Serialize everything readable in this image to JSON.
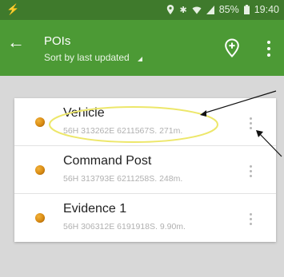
{
  "status": {
    "battery": "85%",
    "time": "19:40",
    "left_icon": "lightning-icon",
    "icons": [
      "location-pin-icon",
      "bluetooth-icon",
      "wifi-icon",
      "signal-icon",
      "battery-icon"
    ]
  },
  "toolbar": {
    "title": "POIs",
    "subtitle": "Sort by last updated",
    "icons": [
      "back-arrow-icon",
      "add-location-icon",
      "overflow-icon"
    ]
  },
  "pois": [
    {
      "name": "Vehicle",
      "meta": "56H 313262E 6211567S. 271m."
    },
    {
      "name": "Command Post",
      "meta": "56H 313793E 6211258S. 248m."
    },
    {
      "name": "Evidence 1",
      "meta": "56H 306312E 6191918S. 9.90m."
    }
  ],
  "colors": {
    "status_bar": "#3f7a2c",
    "toolbar": "#4c9a35",
    "background": "#d8d8d8",
    "highlight": "#ede76a",
    "poi_dot": "#e89a1e"
  }
}
